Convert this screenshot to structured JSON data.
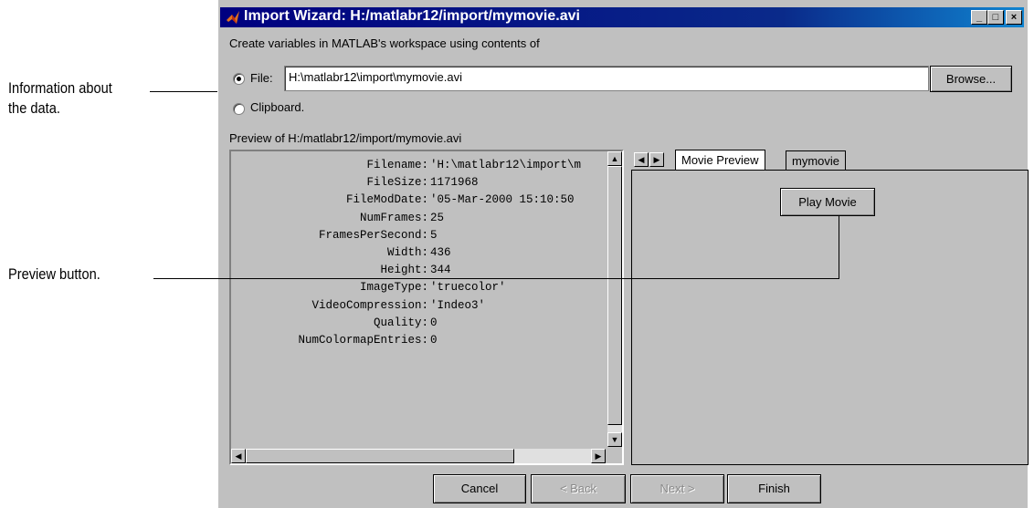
{
  "annotations": {
    "info": [
      "Information about",
      "the data."
    ],
    "preview": "Preview button."
  },
  "window": {
    "title": "Import Wizard: H:/matlabr12/import/mymovie.avi",
    "controls": {
      "minimize": "_",
      "maximize": "□",
      "close": "×"
    }
  },
  "intro_text": "Create variables in MATLAB's workspace using contents of",
  "source": {
    "file_label": "File:",
    "file_value": "H:\\matlabr12\\import\\mymovie.avi",
    "browse_label": "Browse...",
    "clipboard_label": "Clipboard.",
    "selected": "file"
  },
  "preview": {
    "heading": "Preview of H:/matlabr12/import/mymovie.avi",
    "fields": [
      {
        "key": "Filename:",
        "value": "'H:\\matlabr12\\import\\m"
      },
      {
        "key": "FileSize:",
        "value": "1171968"
      },
      {
        "key": "FileModDate:",
        "value": "'05-Mar-2000 15:10:50"
      },
      {
        "key": "NumFrames:",
        "value": "25"
      },
      {
        "key": "FramesPerSecond:",
        "value": "5"
      },
      {
        "key": "Width:",
        "value": "436"
      },
      {
        "key": "Height:",
        "value": "344"
      },
      {
        "key": "ImageType:",
        "value": "'truecolor'"
      },
      {
        "key": "VideoCompression:",
        "value": "'Indeo3'"
      },
      {
        "key": "Quality:",
        "value": "0"
      },
      {
        "key": "NumColormapEntries:",
        "value": "0"
      }
    ]
  },
  "tabs": {
    "items": [
      "Movie Preview",
      "mymovie"
    ],
    "active": "Movie Preview",
    "play_button": "Play Movie"
  },
  "footer": {
    "cancel": "Cancel",
    "back": "< Back",
    "next": "Next >",
    "finish": "Finish"
  }
}
